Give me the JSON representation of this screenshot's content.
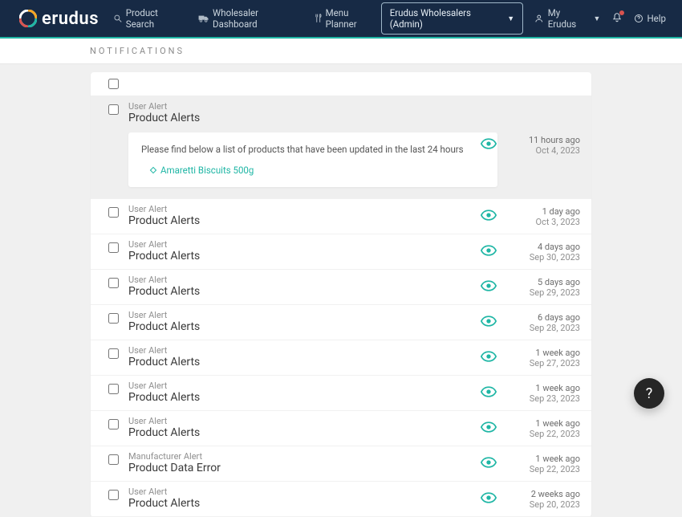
{
  "brand": {
    "name": "erudus"
  },
  "nav": {
    "product_search": "Product Search",
    "wholesaler_dashboard": "Wholesaler Dashboard",
    "menu_planner": "Menu Planner",
    "account_dropdown": "Erudus Wholesalers (Admin)",
    "my_erudus": "My Erudus",
    "help": "Help"
  },
  "page": {
    "title": "Notifications"
  },
  "expanded_message": {
    "intro": "Please find below a list of products that have been updated in the last 24 hours",
    "product_name": "Amaretti Biscuits 500g"
  },
  "notifications": [
    {
      "category": "User Alert",
      "title": "Product Alerts",
      "relative": "11 hours ago",
      "absolute": "Oct 4, 2023",
      "expanded": true
    },
    {
      "category": "User Alert",
      "title": "Product Alerts",
      "relative": "1 day ago",
      "absolute": "Oct 3, 2023"
    },
    {
      "category": "User Alert",
      "title": "Product Alerts",
      "relative": "4 days ago",
      "absolute": "Sep 30, 2023"
    },
    {
      "category": "User Alert",
      "title": "Product Alerts",
      "relative": "5 days ago",
      "absolute": "Sep 29, 2023"
    },
    {
      "category": "User Alert",
      "title": "Product Alerts",
      "relative": "6 days ago",
      "absolute": "Sep 28, 2023"
    },
    {
      "category": "User Alert",
      "title": "Product Alerts",
      "relative": "1 week ago",
      "absolute": "Sep 27, 2023"
    },
    {
      "category": "User Alert",
      "title": "Product Alerts",
      "relative": "1 week ago",
      "absolute": "Sep 23, 2023"
    },
    {
      "category": "User Alert",
      "title": "Product Alerts",
      "relative": "1 week ago",
      "absolute": "Sep 22, 2023"
    },
    {
      "category": "Manufacturer Alert",
      "title": "Product Data Error",
      "relative": "1 week ago",
      "absolute": "Sep 22, 2023"
    },
    {
      "category": "User Alert",
      "title": "Product Alerts",
      "relative": "2 weeks ago",
      "absolute": "Sep 20, 2023"
    }
  ],
  "fab": {
    "label": "?"
  }
}
